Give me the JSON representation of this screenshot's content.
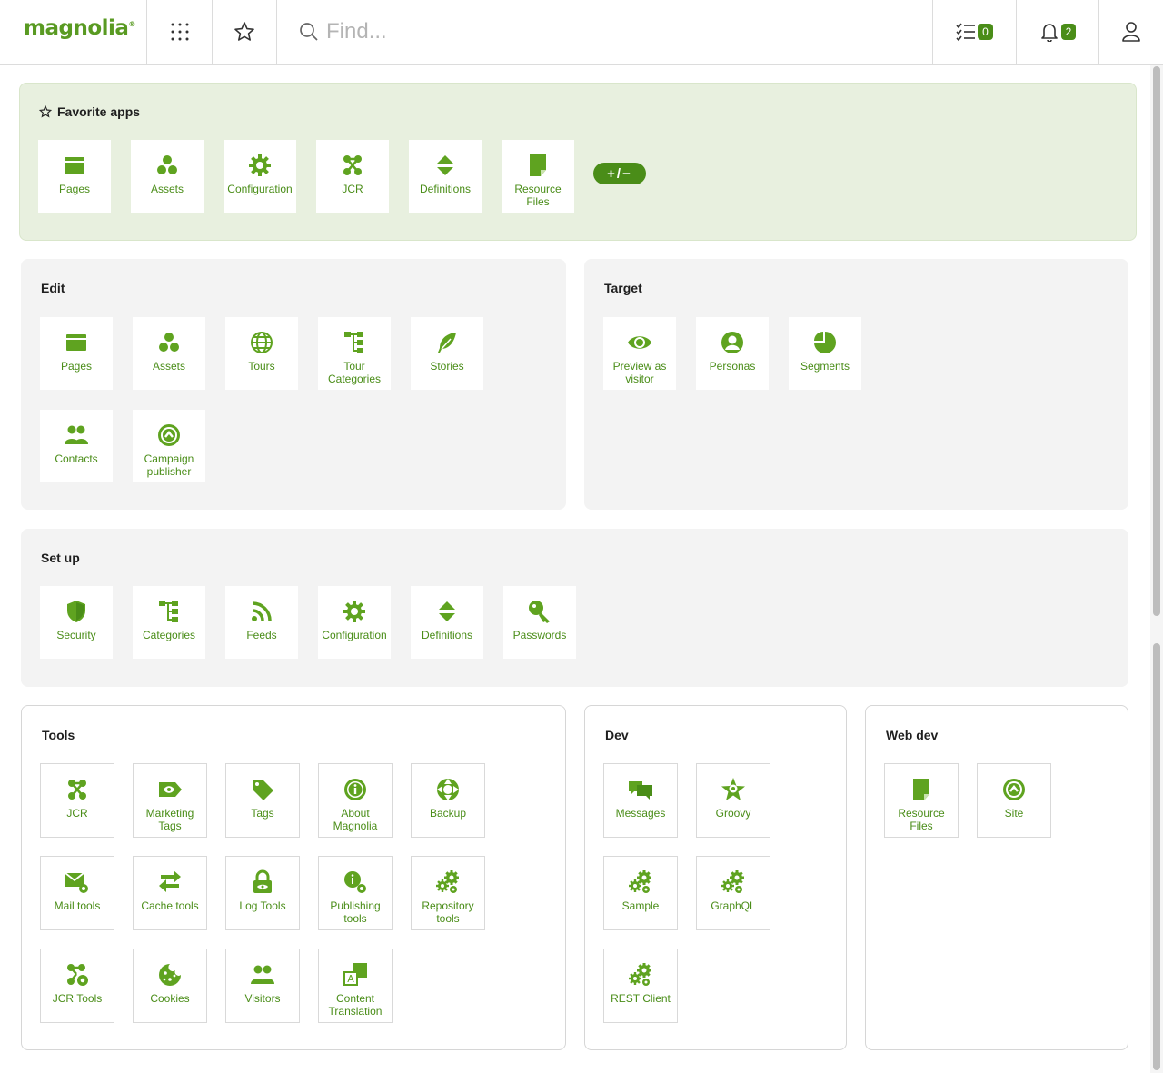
{
  "header": {
    "logo": "magnolia",
    "logo_mark": "®",
    "search_placeholder": "Find...",
    "tasks_count": "0",
    "notifications_count": "2"
  },
  "favorites": {
    "title": "Favorite apps",
    "toggle_label": "+/−",
    "apps": [
      {
        "label": "Pages",
        "icon": "pages-icon"
      },
      {
        "label": "Assets",
        "icon": "assets-icon"
      },
      {
        "label": "Configuration",
        "icon": "configuration-icon"
      },
      {
        "label": "JCR",
        "icon": "jcr-icon"
      },
      {
        "label": "Definitions",
        "icon": "definitions-icon"
      },
      {
        "label": "Resource Files",
        "icon": "resource-files-icon"
      }
    ]
  },
  "groups": {
    "edit": {
      "title": "Edit",
      "apps": [
        {
          "label": "Pages"
        },
        {
          "label": "Assets"
        },
        {
          "label": "Tours"
        },
        {
          "label": "Tour Categories"
        },
        {
          "label": "Stories"
        },
        {
          "label": "Contacts"
        },
        {
          "label": "Campaign publisher"
        }
      ]
    },
    "target": {
      "title": "Target",
      "apps": [
        {
          "label": "Preview as visitor"
        },
        {
          "label": "Personas"
        },
        {
          "label": "Segments"
        }
      ]
    },
    "setup": {
      "title": "Set up",
      "apps": [
        {
          "label": "Security"
        },
        {
          "label": "Categories"
        },
        {
          "label": "Feeds"
        },
        {
          "label": "Configuration"
        },
        {
          "label": "Definitions"
        },
        {
          "label": "Passwords"
        }
      ]
    },
    "tools": {
      "title": "Tools",
      "apps": [
        {
          "label": "JCR"
        },
        {
          "label": "Marketing Tags"
        },
        {
          "label": "Tags"
        },
        {
          "label": "About Magnolia"
        },
        {
          "label": "Backup"
        },
        {
          "label": "Mail tools"
        },
        {
          "label": "Cache tools"
        },
        {
          "label": "Log Tools"
        },
        {
          "label": "Publishing tools"
        },
        {
          "label": "Repository tools"
        },
        {
          "label": "JCR Tools"
        },
        {
          "label": "Cookies"
        },
        {
          "label": "Visitors"
        },
        {
          "label": "Content Translation"
        }
      ]
    },
    "dev": {
      "title": "Dev",
      "apps": [
        {
          "label": "Messages"
        },
        {
          "label": "Groovy"
        },
        {
          "label": "Sample"
        },
        {
          "label": "GraphQL"
        },
        {
          "label": "REST Client"
        }
      ]
    },
    "webdev": {
      "title": "Web dev",
      "apps": [
        {
          "label": "Resource Files"
        },
        {
          "label": "Site"
        }
      ]
    }
  },
  "colors": {
    "accent": "#4a8d18",
    "icon_green": "#5fa320",
    "favorites_bg": "#e8f0df",
    "panel_grey": "#f3f3f3"
  }
}
